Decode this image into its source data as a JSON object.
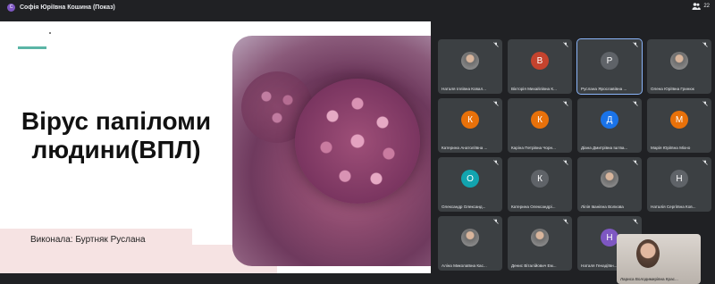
{
  "topbar": {
    "presenter_initial": "С",
    "presenter_title": "Софія Юріївна Кошина (Показ)",
    "participants_count": "22"
  },
  "slide": {
    "title_line1": "Вірус папіломи",
    "title_line2": "людини(ВПЛ)",
    "author": "Виконала: Буртняк Руслана"
  },
  "tiles": [
    {
      "name": "Наталя Іллівна Ковал...",
      "avatar": "photo"
    },
    {
      "name": "Вікторія Михайлівна К...",
      "initial": "В",
      "color": "#c4432e"
    },
    {
      "name": "Руслана Ярославівна ...",
      "initial": "Р",
      "color": "#5f6368"
    },
    {
      "name": "Олена Юріївна Гринюк",
      "avatar": "photo"
    },
    {
      "name": "Катерина Анатоліївна ...",
      "initial": "К",
      "color": "#e8710a"
    },
    {
      "name": "Каріна Петрівна Чорн...",
      "initial": "К",
      "color": "#e8710a"
    },
    {
      "name": "Діана Дмитрівна Іштва...",
      "initial": "Д",
      "color": "#1a73e8"
    },
    {
      "name": "Марія Юріївна Міхно",
      "initial": "М",
      "color": "#e8710a"
    },
    {
      "name": "Олександр Олександ...",
      "initial": "О",
      "color": "#12a4af"
    },
    {
      "name": "Катерина Олександрі...",
      "initial": "К",
      "color": "#5f6368"
    },
    {
      "name": "Лілія Іванівна Волкова",
      "avatar": "photo"
    },
    {
      "name": "Наталія Сергіївна Ков...",
      "initial": "Н",
      "color": "#5f6368"
    },
    {
      "name": "Аліна Миколаївна Кас...",
      "avatar": "photo"
    },
    {
      "name": "Денис Віталійович Ем...",
      "avatar": "photo"
    },
    {
      "name": "Наталя Генадіївн...",
      "initial": "Н",
      "color": "#7e57c2"
    }
  ],
  "self_view": {
    "name": "Лариса Володимирівна Крас..."
  }
}
